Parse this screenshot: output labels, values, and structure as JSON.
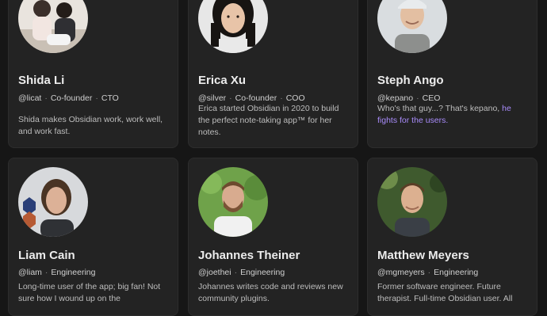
{
  "team": [
    {
      "name": "Shida Li",
      "handle": "@licat",
      "role": "Co-founder",
      "title": "CTO",
      "bio": "Shida makes Obsidian work, work well, and work fast.",
      "avatar": "family-photo-avatar"
    },
    {
      "name": "Erica Xu",
      "handle": "@silver",
      "role": "Co-founder",
      "title": "COO",
      "bio": "Erica started Obsidian in 2020 to build the perfect note-taking app™ for her notes.",
      "avatar": "woman-portrait-avatar"
    },
    {
      "name": "Steph Ango",
      "handle": "@kepano",
      "title": "CEO",
      "bio": "Who's that guy...? That's kepano,",
      "bio_link": "he fights for the users.",
      "avatar": "man-cap-avatar"
    },
    {
      "name": "Liam Cain",
      "handle": "@liam",
      "role": "Engineering",
      "bio": "Long-time user of the app; big fan! Not sure how I wound up on the",
      "avatar": "man-long-hair-avatar"
    },
    {
      "name": "Johannes Theiner",
      "handle": "@joethei",
      "role": "Engineering",
      "bio": "Johannes writes code and reviews new community plugins.",
      "avatar": "man-beard-avatar"
    },
    {
      "name": "Matthew Meyers",
      "handle": "@mgmeyers",
      "role": "Engineering",
      "bio": "Former software engineer. Future therapist. Full-time Obsidian user. All",
      "avatar": "man-smile-avatar"
    }
  ],
  "colors": {
    "page_bg": "#161616",
    "card_bg": "#232323",
    "link": "#a88bfa"
  }
}
